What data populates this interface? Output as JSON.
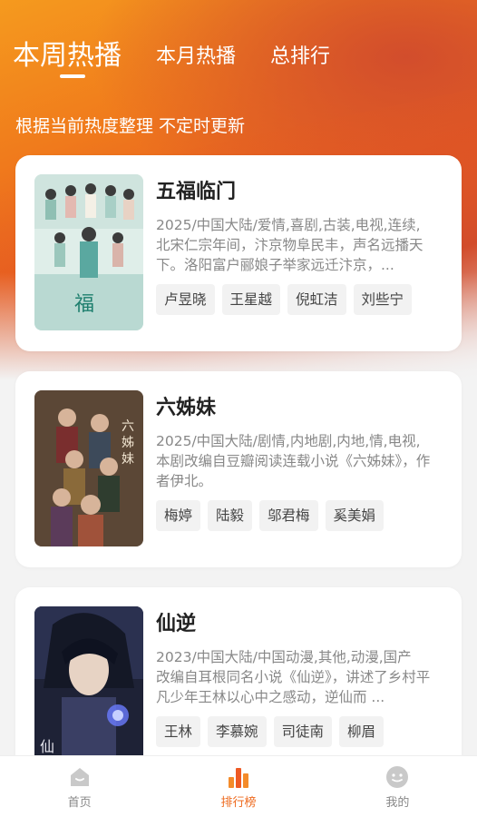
{
  "tabs": [
    {
      "label": "本周热播",
      "active": true
    },
    {
      "label": "本月热播",
      "active": false
    },
    {
      "label": "总排行",
      "active": false
    }
  ],
  "subtitle": "根据当前热度整理 不定时更新",
  "cards": [
    {
      "title": "五福临门",
      "meta": "2025/中国大陆/爱情,喜剧,古装,电视,连续,",
      "desc": "北宋仁宗年间，汴京物阜民丰，声名远播天下。洛阳富户郦娘子举家远迁汴京，...",
      "cast": [
        "卢昱晓",
        "王星越",
        "倪虹洁",
        "刘些宁"
      ]
    },
    {
      "title": "六姊妹",
      "meta": "2025/中国大陆/剧情,内地剧,内地,情,电视,",
      "desc": "本剧改编自豆瓣阅读连载小说《六姊妹》，作者伊北。",
      "cast": [
        "梅婷",
        "陆毅",
        "邬君梅",
        "奚美娟"
      ]
    },
    {
      "title": "仙逆",
      "meta": "2023/中国大陆/中国动漫,其他,动漫,国产",
      "desc": "改编自耳根同名小说《仙逆》，讲述了乡村平凡少年王林以心中之感动，逆仙而 ...",
      "cast": [
        "王林",
        "李慕婉",
        "司徒南",
        "柳眉"
      ]
    }
  ],
  "nav": [
    {
      "label": "首页",
      "icon": "home-icon",
      "active": false
    },
    {
      "label": "排行榜",
      "icon": "ranking-icon",
      "active": true
    },
    {
      "label": "我的",
      "icon": "profile-icon",
      "active": false
    }
  ],
  "colors": {
    "accent": "#ee6a1e",
    "hero_orange": "#f07a1c",
    "hero_red": "#cf4a2d"
  }
}
